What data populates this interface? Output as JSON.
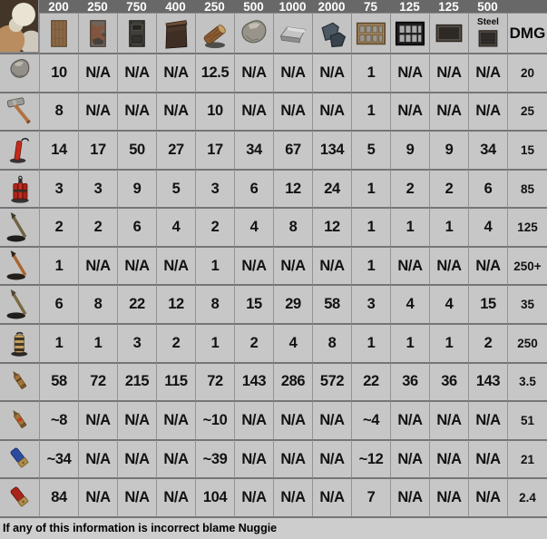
{
  "colors": {
    "background": "#c6c6c6",
    "header_strip": "#686868",
    "header_text": "#ffffff",
    "cell_text": "#121212",
    "grid_line": "#939393",
    "row_line": "#757575"
  },
  "chart_data": {
    "type": "table",
    "description": "Hits/items required to destroy each structure (columns, labeled with structure HP) using each tool/ammo (rows); last column is damage per hit.",
    "columns": [
      {
        "hp": "200",
        "icon": "wooden-door-icon"
      },
      {
        "hp": "250",
        "icon": "sheet-metal-door-icon"
      },
      {
        "hp": "750",
        "icon": "armored-door-icon"
      },
      {
        "hp": "400",
        "icon": "garage-door-icon"
      },
      {
        "hp": "250",
        "icon": "wood-material-icon"
      },
      {
        "hp": "500",
        "icon": "stone-material-icon"
      },
      {
        "hp": "1000",
        "icon": "metal-material-icon"
      },
      {
        "hp": "2000",
        "icon": "armored-material-icon"
      },
      {
        "hp": "75",
        "icon": "wooden-window-bars-icon"
      },
      {
        "hp": "125",
        "icon": "metal-window-bars-icon"
      },
      {
        "hp": "125",
        "icon": "metal-shutter-icon"
      },
      {
        "hp": "500",
        "icon": "steel-shutter-icon",
        "sublabel": "Steel"
      }
    ],
    "dmg_header": "DMG",
    "rows": [
      {
        "icon": "rock-icon",
        "values": [
          "10",
          "N/A",
          "N/A",
          "N/A",
          "12.5",
          "N/A",
          "N/A",
          "N/A",
          "1",
          "N/A",
          "N/A",
          "N/A"
        ],
        "dmg": "20"
      },
      {
        "icon": "hammer-icon",
        "values": [
          "8",
          "N/A",
          "N/A",
          "N/A",
          "10",
          "N/A",
          "N/A",
          "N/A",
          "1",
          "N/A",
          "N/A",
          "N/A"
        ],
        "dmg": "25"
      },
      {
        "icon": "dynamite-icon",
        "values": [
          "14",
          "17",
          "50",
          "27",
          "17",
          "34",
          "67",
          "134",
          "5",
          "9",
          "9",
          "34"
        ],
        "dmg": "15"
      },
      {
        "icon": "tnt-bundle-icon",
        "values": [
          "3",
          "3",
          "9",
          "5",
          "3",
          "6",
          "12",
          "24",
          "1",
          "2",
          "2",
          "6"
        ],
        "dmg": "85"
      },
      {
        "icon": "spear-icon",
        "values": [
          "2",
          "2",
          "6",
          "4",
          "2",
          "4",
          "8",
          "12",
          "1",
          "1",
          "1",
          "4"
        ],
        "dmg": "125"
      },
      {
        "icon": "flaming-spear-icon",
        "values": [
          "1",
          "N/A",
          "N/A",
          "N/A",
          "1",
          "N/A",
          "N/A",
          "N/A",
          "1",
          "N/A",
          "N/A",
          "N/A"
        ],
        "dmg": "250+"
      },
      {
        "icon": "wooden-spear-icon",
        "values": [
          "6",
          "8",
          "22",
          "12",
          "8",
          "15",
          "29",
          "58",
          "3",
          "4",
          "4",
          "15"
        ],
        "dmg": "35"
      },
      {
        "icon": "explosive-bundle-icon",
        "values": [
          "1",
          "1",
          "3",
          "2",
          "1",
          "2",
          "4",
          "8",
          "1",
          "1",
          "1",
          "2"
        ],
        "dmg": "250"
      },
      {
        "icon": "rifle-round-icon",
        "values": [
          "58",
          "72",
          "215",
          "115",
          "72",
          "143",
          "286",
          "572",
          "22",
          "36",
          "36",
          "143"
        ],
        "dmg": "3.5"
      },
      {
        "icon": "incendiary-round-icon",
        "values": [
          "~8",
          "N/A",
          "N/A",
          "N/A",
          "~10",
          "N/A",
          "N/A",
          "N/A",
          "~4",
          "N/A",
          "N/A",
          "N/A"
        ],
        "dmg": "51"
      },
      {
        "icon": "slug-shell-icon",
        "values": [
          "~34",
          "N/A",
          "N/A",
          "N/A",
          "~39",
          "N/A",
          "N/A",
          "N/A",
          "~12",
          "N/A",
          "N/A",
          "N/A"
        ],
        "dmg": "21"
      },
      {
        "icon": "buckshot-shell-icon",
        "values": [
          "84",
          "N/A",
          "N/A",
          "N/A",
          "104",
          "N/A",
          "N/A",
          "N/A",
          "7",
          "N/A",
          "N/A",
          "N/A"
        ],
        "dmg": "2.4"
      }
    ]
  },
  "footer": {
    "note": "If any of this information is incorrect blame Nuggie"
  }
}
